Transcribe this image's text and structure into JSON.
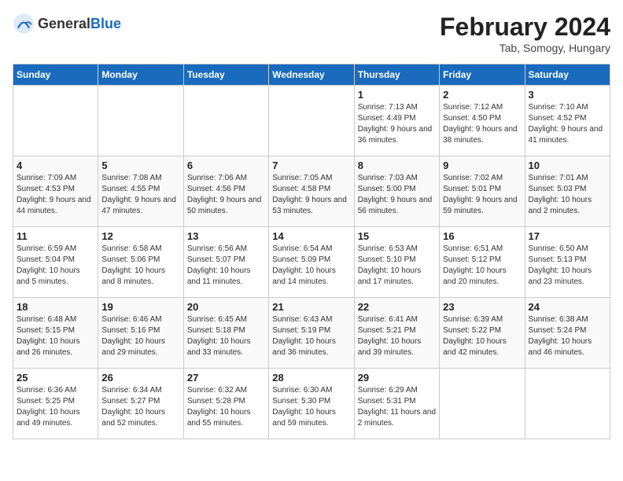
{
  "header": {
    "logo_general": "General",
    "logo_blue": "Blue",
    "title": "February 2024",
    "location": "Tab, Somogy, Hungary"
  },
  "days_of_week": [
    "Sunday",
    "Monday",
    "Tuesday",
    "Wednesday",
    "Thursday",
    "Friday",
    "Saturday"
  ],
  "weeks": [
    [
      {
        "day": "",
        "sunrise": "",
        "sunset": "",
        "daylight": ""
      },
      {
        "day": "",
        "sunrise": "",
        "sunset": "",
        "daylight": ""
      },
      {
        "day": "",
        "sunrise": "",
        "sunset": "",
        "daylight": ""
      },
      {
        "day": "",
        "sunrise": "",
        "sunset": "",
        "daylight": ""
      },
      {
        "day": "1",
        "sunrise": "Sunrise: 7:13 AM",
        "sunset": "Sunset: 4:49 PM",
        "daylight": "Daylight: 9 hours and 36 minutes."
      },
      {
        "day": "2",
        "sunrise": "Sunrise: 7:12 AM",
        "sunset": "Sunset: 4:50 PM",
        "daylight": "Daylight: 9 hours and 38 minutes."
      },
      {
        "day": "3",
        "sunrise": "Sunrise: 7:10 AM",
        "sunset": "Sunset: 4:52 PM",
        "daylight": "Daylight: 9 hours and 41 minutes."
      }
    ],
    [
      {
        "day": "4",
        "sunrise": "Sunrise: 7:09 AM",
        "sunset": "Sunset: 4:53 PM",
        "daylight": "Daylight: 9 hours and 44 minutes."
      },
      {
        "day": "5",
        "sunrise": "Sunrise: 7:08 AM",
        "sunset": "Sunset: 4:55 PM",
        "daylight": "Daylight: 9 hours and 47 minutes."
      },
      {
        "day": "6",
        "sunrise": "Sunrise: 7:06 AM",
        "sunset": "Sunset: 4:56 PM",
        "daylight": "Daylight: 9 hours and 50 minutes."
      },
      {
        "day": "7",
        "sunrise": "Sunrise: 7:05 AM",
        "sunset": "Sunset: 4:58 PM",
        "daylight": "Daylight: 9 hours and 53 minutes."
      },
      {
        "day": "8",
        "sunrise": "Sunrise: 7:03 AM",
        "sunset": "Sunset: 5:00 PM",
        "daylight": "Daylight: 9 hours and 56 minutes."
      },
      {
        "day": "9",
        "sunrise": "Sunrise: 7:02 AM",
        "sunset": "Sunset: 5:01 PM",
        "daylight": "Daylight: 9 hours and 59 minutes."
      },
      {
        "day": "10",
        "sunrise": "Sunrise: 7:01 AM",
        "sunset": "Sunset: 5:03 PM",
        "daylight": "Daylight: 10 hours and 2 minutes."
      }
    ],
    [
      {
        "day": "11",
        "sunrise": "Sunrise: 6:59 AM",
        "sunset": "Sunset: 5:04 PM",
        "daylight": "Daylight: 10 hours and 5 minutes."
      },
      {
        "day": "12",
        "sunrise": "Sunrise: 6:58 AM",
        "sunset": "Sunset: 5:06 PM",
        "daylight": "Daylight: 10 hours and 8 minutes."
      },
      {
        "day": "13",
        "sunrise": "Sunrise: 6:56 AM",
        "sunset": "Sunset: 5:07 PM",
        "daylight": "Daylight: 10 hours and 11 minutes."
      },
      {
        "day": "14",
        "sunrise": "Sunrise: 6:54 AM",
        "sunset": "Sunset: 5:09 PM",
        "daylight": "Daylight: 10 hours and 14 minutes."
      },
      {
        "day": "15",
        "sunrise": "Sunrise: 6:53 AM",
        "sunset": "Sunset: 5:10 PM",
        "daylight": "Daylight: 10 hours and 17 minutes."
      },
      {
        "day": "16",
        "sunrise": "Sunrise: 6:51 AM",
        "sunset": "Sunset: 5:12 PM",
        "daylight": "Daylight: 10 hours and 20 minutes."
      },
      {
        "day": "17",
        "sunrise": "Sunrise: 6:50 AM",
        "sunset": "Sunset: 5:13 PM",
        "daylight": "Daylight: 10 hours and 23 minutes."
      }
    ],
    [
      {
        "day": "18",
        "sunrise": "Sunrise: 6:48 AM",
        "sunset": "Sunset: 5:15 PM",
        "daylight": "Daylight: 10 hours and 26 minutes."
      },
      {
        "day": "19",
        "sunrise": "Sunrise: 6:46 AM",
        "sunset": "Sunset: 5:16 PM",
        "daylight": "Daylight: 10 hours and 29 minutes."
      },
      {
        "day": "20",
        "sunrise": "Sunrise: 6:45 AM",
        "sunset": "Sunset: 5:18 PM",
        "daylight": "Daylight: 10 hours and 33 minutes."
      },
      {
        "day": "21",
        "sunrise": "Sunrise: 6:43 AM",
        "sunset": "Sunset: 5:19 PM",
        "daylight": "Daylight: 10 hours and 36 minutes."
      },
      {
        "day": "22",
        "sunrise": "Sunrise: 6:41 AM",
        "sunset": "Sunset: 5:21 PM",
        "daylight": "Daylight: 10 hours and 39 minutes."
      },
      {
        "day": "23",
        "sunrise": "Sunrise: 6:39 AM",
        "sunset": "Sunset: 5:22 PM",
        "daylight": "Daylight: 10 hours and 42 minutes."
      },
      {
        "day": "24",
        "sunrise": "Sunrise: 6:38 AM",
        "sunset": "Sunset: 5:24 PM",
        "daylight": "Daylight: 10 hours and 46 minutes."
      }
    ],
    [
      {
        "day": "25",
        "sunrise": "Sunrise: 6:36 AM",
        "sunset": "Sunset: 5:25 PM",
        "daylight": "Daylight: 10 hours and 49 minutes."
      },
      {
        "day": "26",
        "sunrise": "Sunrise: 6:34 AM",
        "sunset": "Sunset: 5:27 PM",
        "daylight": "Daylight: 10 hours and 52 minutes."
      },
      {
        "day": "27",
        "sunrise": "Sunrise: 6:32 AM",
        "sunset": "Sunset: 5:28 PM",
        "daylight": "Daylight: 10 hours and 55 minutes."
      },
      {
        "day": "28",
        "sunrise": "Sunrise: 6:30 AM",
        "sunset": "Sunset: 5:30 PM",
        "daylight": "Daylight: 10 hours and 59 minutes."
      },
      {
        "day": "29",
        "sunrise": "Sunrise: 6:29 AM",
        "sunset": "Sunset: 5:31 PM",
        "daylight": "Daylight: 11 hours and 2 minutes."
      },
      {
        "day": "",
        "sunrise": "",
        "sunset": "",
        "daylight": ""
      },
      {
        "day": "",
        "sunrise": "",
        "sunset": "",
        "daylight": ""
      }
    ]
  ]
}
